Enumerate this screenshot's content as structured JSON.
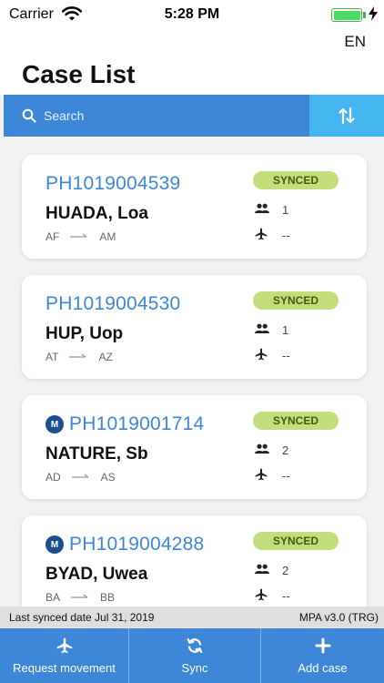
{
  "status_bar": {
    "carrier": "Carrier",
    "time": "5:28 PM"
  },
  "header": {
    "language": "EN",
    "title": "Case List"
  },
  "search": {
    "placeholder": "Search"
  },
  "cases": [
    {
      "id": "PH1019004539",
      "name": "HUADA, Loa",
      "from": "AF",
      "to": "AM",
      "status": "SYNCED",
      "people": "1",
      "flight": "--",
      "has_logo": false
    },
    {
      "id": "PH1019004530",
      "name": "HUP, Uop",
      "from": "AT",
      "to": "AZ",
      "status": "SYNCED",
      "people": "1",
      "flight": "--",
      "has_logo": false
    },
    {
      "id": "PH1019001714",
      "name": "NATURE, Sb",
      "from": "AD",
      "to": "AS",
      "status": "SYNCED",
      "people": "2",
      "flight": "--",
      "has_logo": true
    },
    {
      "id": "PH1019004288",
      "name": "BYAD, Uwea",
      "from": "BA",
      "to": "BB",
      "status": "SYNCED",
      "people": "2",
      "flight": "--",
      "has_logo": true
    }
  ],
  "footer": {
    "last_synced": "Last synced date Jul 31, 2019",
    "version": "MPA v3.0 (TRG)"
  },
  "toolbar": {
    "request_movement": "Request movement",
    "sync": "Sync",
    "add_case": "Add case"
  },
  "colors": {
    "primary": "#3d86d8",
    "sort_button": "#45b5f0",
    "synced_badge": "#c3de7a",
    "battery": "#4cd964"
  },
  "icons": {
    "wifi": "wifi-icon",
    "battery": "battery-icon",
    "search": "search-icon",
    "sort": "sort-icon",
    "people": "people-icon",
    "flight": "plane-icon",
    "request_movement": "plane-icon",
    "sync": "sync-icon",
    "add_case": "plus-icon"
  }
}
